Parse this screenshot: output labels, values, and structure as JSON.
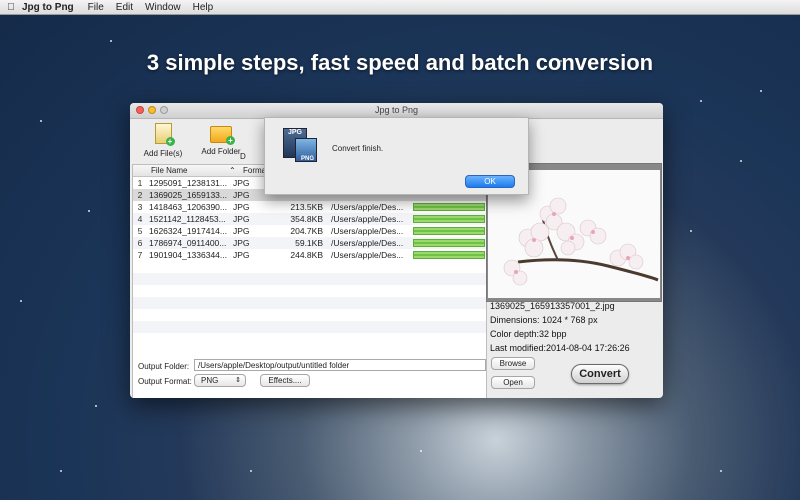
{
  "menubar": {
    "app_name": "Jpg to Png",
    "items": [
      "File",
      "Edit",
      "Window",
      "Help"
    ]
  },
  "headline": "3 simple steps, fast speed and batch conversion",
  "window": {
    "title": "Jpg to Png",
    "toolbar": {
      "add_files": "Add File(s)",
      "add_folder": "Add Folder",
      "third_partial": "D"
    },
    "table": {
      "headers": {
        "name": "File Name",
        "format": "Format",
        "sort_indicator": "⌃"
      },
      "rows": [
        {
          "num": "1",
          "name": "1295091_1238131...",
          "format": "JPG",
          "size": "",
          "path": "",
          "progress": 0
        },
        {
          "num": "2",
          "name": "1369025_1659133...",
          "format": "JPG",
          "size": "",
          "path": "",
          "progress": 0
        },
        {
          "num": "3",
          "name": "1418463_1206390...",
          "format": "JPG",
          "size": "213.5KB",
          "path": "/Users/apple/Des...",
          "progress": 1
        },
        {
          "num": "4",
          "name": "1521142_1128453...",
          "format": "JPG",
          "size": "354.8KB",
          "path": "/Users/apple/Des...",
          "progress": 1
        },
        {
          "num": "5",
          "name": "1626324_1917414...",
          "format": "JPG",
          "size": "204.7KB",
          "path": "/Users/apple/Des...",
          "progress": 1
        },
        {
          "num": "6",
          "name": "1786974_0911400...",
          "format": "JPG",
          "size": "59.1KB",
          "path": "/Users/apple/Des...",
          "progress": 1
        },
        {
          "num": "7",
          "name": "1901904_1336344...",
          "format": "JPG",
          "size": "244.8KB",
          "path": "/Users/apple/Des...",
          "progress": 1
        }
      ]
    },
    "output": {
      "folder_label": "Output Folder:",
      "folder_value": "/Users/apple/Desktop/output/untitled folder",
      "format_label": "Output Format:",
      "format_value": "PNG",
      "effects_label": "Effects....",
      "browse_label": "Browse",
      "open_label": "Open",
      "convert_label": "Convert"
    },
    "preview": {
      "filename": "1369025_165913357001_2.jpg",
      "dimensions": "Dimensions: 1024 * 768 px",
      "color_depth": "Color depth:32 bpp",
      "last_modified": "Last modified:2014-08-04 17:26:26"
    },
    "dialog": {
      "icon_top": "JPG",
      "icon_bottom": "PNG",
      "message": "Convert finish.",
      "ok_label": "OK"
    }
  }
}
